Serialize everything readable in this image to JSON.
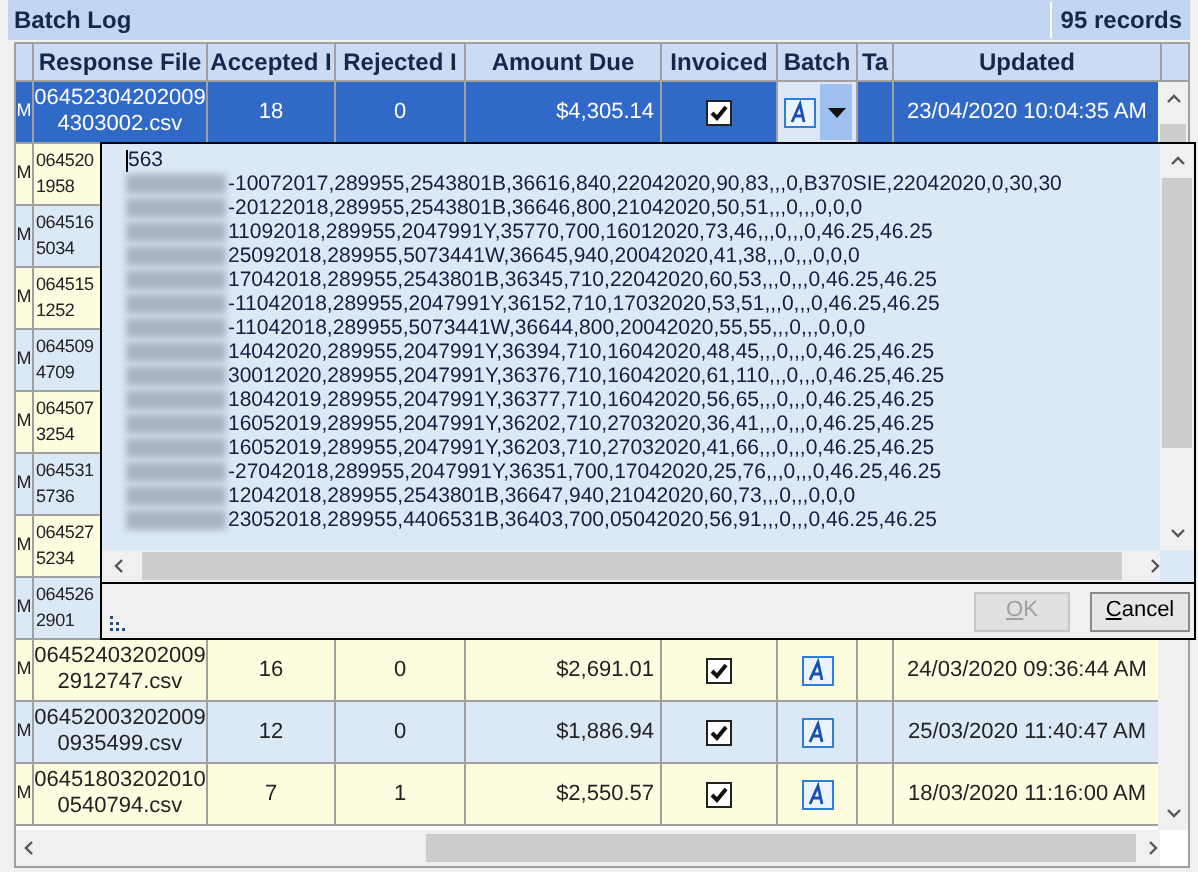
{
  "title": "Batch Log",
  "record_count": "95 records",
  "columns": [
    {
      "label": "Response File"
    },
    {
      "label": "Accepted I"
    },
    {
      "label": "Rejected I"
    },
    {
      "label": "Amount Due"
    },
    {
      "label": "Invoiced"
    },
    {
      "label": "Batch"
    },
    {
      "label": "Ta"
    },
    {
      "label": "Updated"
    }
  ],
  "rows": [
    {
      "column_1": "M",
      "response_file": [
        "06452304202009",
        "4303002.csv"
      ],
      "accepted": "18",
      "rejected": "0",
      "amount_due": "$4,305.14",
      "invoiced": true,
      "updated": "23/04/2020 10:04:35 AM",
      "selected": true
    },
    {
      "column_1": "M",
      "response_file": [
        "064520",
        "1958"
      ],
      "selected": false
    },
    {
      "column_1": "M",
      "response_file": [
        "064516",
        "5034"
      ],
      "selected": false
    },
    {
      "column_1": "M",
      "response_file": [
        "064515",
        "1252"
      ],
      "selected": false
    },
    {
      "column_1": "M",
      "response_file": [
        "064509",
        "4709"
      ],
      "selected": false
    },
    {
      "column_1": "M",
      "response_file": [
        "064507",
        "3254"
      ],
      "selected": false
    },
    {
      "column_1": "M",
      "response_file": [
        "064531",
        "5736"
      ],
      "selected": false
    },
    {
      "column_1": "M",
      "response_file": [
        "064527",
        "5234"
      ],
      "selected": false
    },
    {
      "column_1": "M",
      "response_file": [
        "064526",
        "2901"
      ],
      "selected": false
    },
    {
      "column_1": "M",
      "response_file": [
        "06452403202009",
        "2912747.csv"
      ],
      "accepted": "16",
      "rejected": "0",
      "amount_due": "$2,691.01",
      "invoiced": true,
      "updated": "24/03/2020 09:36:44 AM",
      "selected": false
    },
    {
      "column_1": "M",
      "response_file": [
        "06452003202009",
        "0935499.csv"
      ],
      "accepted": "12",
      "rejected": "0",
      "amount_due": "$1,886.94",
      "invoiced": true,
      "updated": "25/03/2020 11:40:47 AM",
      "selected": false
    },
    {
      "column_1": "M",
      "response_file": [
        "06451803202010",
        "0540794.csv"
      ],
      "accepted": "7",
      "rejected": "1",
      "amount_due": "$2,550.57",
      "invoiced": true,
      "updated": "18/03/2020 11:16:00 AM",
      "selected": false
    }
  ],
  "popup": {
    "first_line": "563",
    "lines": [
      "-10072017,289955,2543801B,36616,840,22042020,90,83,,,0,B370SIE,22042020,0,30,30",
      "-20122018,289955,2543801B,36646,800,21042020,50,51,,,0,,,0,0,0",
      "11092018,289955,2047991Y,35770,700,16012020,73,46,,,0,,,0,46.25,46.25",
      "25092018,289955,5073441W,36645,940,20042020,41,38,,,0,,,0,0,0",
      "17042018,289955,2543801B,36345,710,22042020,60,53,,,0,,,0,46.25,46.25",
      "-11042018,289955,2047991Y,36152,710,17032020,53,51,,,0,,,0,46.25,46.25",
      "-11042018,289955,5073441W,36644,800,20042020,55,55,,,0,,,0,0,0",
      "14042020,289955,2047991Y,36394,710,16042020,48,45,,,0,,,0,46.25,46.25",
      "30012020,289955,2047991Y,36376,710,16042020,61,110,,,0,,,0,46.25,46.25",
      "18042019,289955,2047991Y,36377,710,16042020,56,65,,,0,,,0,46.25,46.25",
      "16052019,289955,2047991Y,36202,710,27032020,36,41,,,0,,,0,46.25,46.25",
      "16052019,289955,2047991Y,36203,710,27032020,41,66,,,0,,,0,46.25,46.25",
      "-27042018,289955,2047991Y,36351,700,17042020,25,76,,,0,,,0,46.25,46.25",
      "12042018,289955,2543801B,36647,940,21042020,60,73,,,0,,,0,0,0",
      "23052018,289955,4406531B,36403,700,05042020,56,91,,,0,,,0,46.25,46.25"
    ],
    "ok": {
      "label": "OK",
      "disabled": true
    },
    "cancel": {
      "label": "Cancel",
      "disabled": false
    }
  }
}
